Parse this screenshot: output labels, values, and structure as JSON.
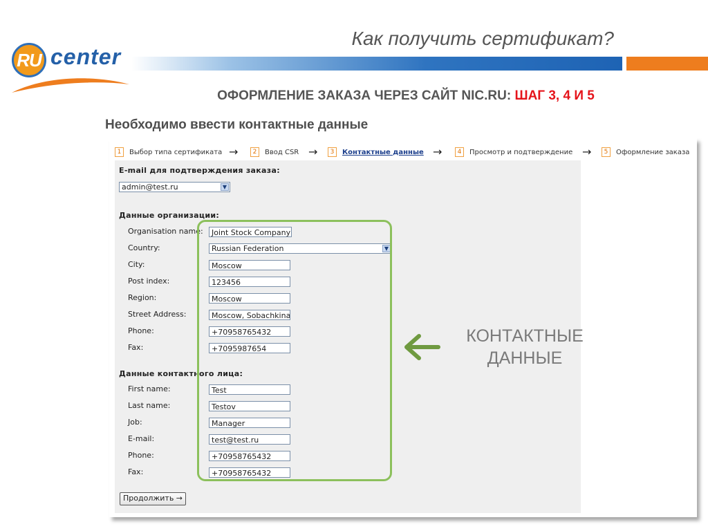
{
  "slide": {
    "title": "Как получить сертификат?",
    "subtitle_main": "ОФОРМЛЕНИЕ ЗАКАЗА ЧЕРЕЗ САЙТ NIC.RU:",
    "subtitle_highlight": "ШАГ 3, 4 И 5",
    "instruction": "Необходимо ввести контактные данные",
    "callout_line1": "КОНТАКТНЫЕ",
    "callout_line2": "ДАННЫЕ"
  },
  "logo": {
    "mark": "RU",
    "word": "center"
  },
  "colors": {
    "blue_bar": "#1e63b4",
    "orange_bar": "#ee7d1e",
    "highlight_red": "#e5141b",
    "green_frame": "#8cc05c"
  },
  "steps": [
    {
      "num": "1",
      "label": "Выбор типа сертификата"
    },
    {
      "num": "2",
      "label": "Ввод CSR"
    },
    {
      "num": "3",
      "label": "Контактные данные"
    },
    {
      "num": "4",
      "label": "Просмотр и подтверждение"
    },
    {
      "num": "5",
      "label": "Оформление заказа"
    }
  ],
  "form": {
    "email_section": "E-mail для подтверждения заказа:",
    "email_value": "admin@test.ru",
    "org_section": "Данные организации:",
    "org": {
      "name_label": "Organisation name:",
      "name_value": "Joint Stock Company",
      "country_label": "Country:",
      "country_value": "Russian Federation",
      "city_label": "City:",
      "city_value": "Moscow",
      "post_label": "Post index:",
      "post_value": "123456",
      "region_label": "Region:",
      "region_value": "Moscow",
      "street_label": "Street Address:",
      "street_value": "Moscow, Sobachkina,",
      "phone_label": "Phone:",
      "phone_value": "+70958765432",
      "fax_label": "Fax:",
      "fax_value": "+7095987654"
    },
    "contact_section": "Данные контактного лица:",
    "contact": {
      "first_label": "First name:",
      "first_value": "Test",
      "last_label": "Last name:",
      "last_value": "Testov",
      "job_label": "Job:",
      "job_value": "Manager",
      "email_label": "E-mail:",
      "email_value": "test@test.ru",
      "phone_label": "Phone:",
      "phone_value": "+70958765432",
      "fax_label": "Fax:",
      "fax_value": "+70958765432"
    },
    "continue_label": "Продолжить →"
  }
}
